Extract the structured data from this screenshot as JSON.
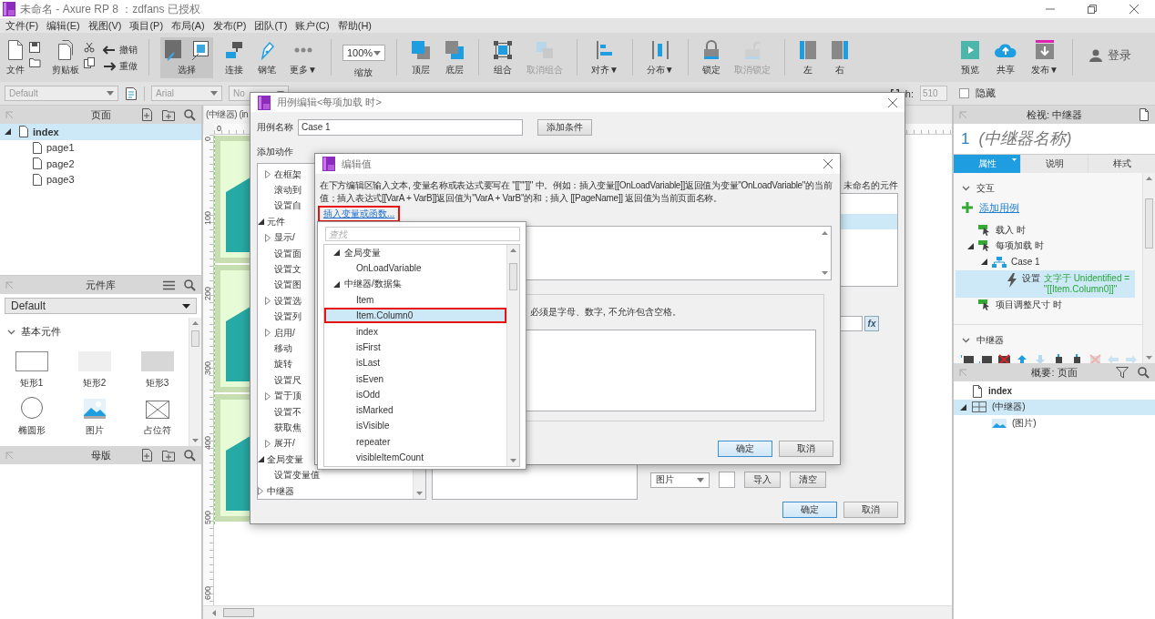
{
  "window": {
    "title": "未命名 - Axure RP 8 ：zdfans 已授权"
  },
  "menu": [
    "文件(F)",
    "编辑(E)",
    "视图(V)",
    "项目(P)",
    "布局(A)",
    "发布(P)",
    "团队(T)",
    "账户(C)",
    "帮助(H)"
  ],
  "toolbar": {
    "left": [
      {
        "kind": "file",
        "label": "文件",
        "disabled": false,
        "selected": false
      },
      {
        "kind": "clipboard",
        "label": "剪贴板",
        "disabled": false,
        "selected": false
      },
      {
        "kind": "history",
        "items": [
          {
            "kind": "undo",
            "label": "撤销"
          },
          {
            "kind": "redo",
            "label": "重做"
          }
        ]
      },
      {
        "kind": "separator"
      },
      {
        "kind": "select",
        "label": "选择",
        "disabled": false,
        "selected": true
      },
      {
        "kind": "connect",
        "label": "连接",
        "disabled": false,
        "selected": false
      },
      {
        "kind": "pen",
        "label": "钢笔",
        "disabled": false,
        "selected": false
      },
      {
        "kind": "more",
        "label": "更多▼",
        "disabled": false,
        "selected": false
      },
      {
        "kind": "separator"
      },
      {
        "kind": "zoom",
        "value": "100%",
        "label": "缩放"
      },
      {
        "kind": "separator"
      },
      {
        "kind": "front",
        "label": "顶层",
        "disabled": false,
        "selected": false
      },
      {
        "kind": "back",
        "label": "底层",
        "disabled": false,
        "selected": false
      },
      {
        "kind": "separator"
      },
      {
        "kind": "group",
        "label": "组合",
        "disabled": false,
        "selected": false
      },
      {
        "kind": "ungroup",
        "label": "取消组合",
        "disabled": true,
        "selected": false
      },
      {
        "kind": "separator"
      },
      {
        "kind": "align",
        "label": "对齐▼",
        "disabled": false,
        "selected": false
      },
      {
        "kind": "separator"
      },
      {
        "kind": "distribute",
        "label": "分布▼",
        "disabled": false,
        "selected": false
      },
      {
        "kind": "separator"
      },
      {
        "kind": "lock",
        "label": "锁定",
        "disabled": false,
        "selected": false
      },
      {
        "kind": "unlock",
        "label": "取消锁定",
        "disabled": true,
        "selected": false
      },
      {
        "kind": "separator"
      },
      {
        "kind": "left",
        "label": "左",
        "disabled": false,
        "selected": false
      },
      {
        "kind": "right",
        "label": "右",
        "disabled": false,
        "selected": false
      }
    ],
    "right": [
      {
        "kind": "preview",
        "label": "预览",
        "disabled": false,
        "selected": false
      },
      {
        "kind": "share",
        "label": "共享",
        "disabled": false,
        "selected": false
      },
      {
        "kind": "publish",
        "label": "发布▼",
        "disabled": false,
        "selected": false
      },
      {
        "kind": "separator"
      },
      {
        "kind": "login",
        "label": "登录"
      }
    ]
  },
  "stylebar": {
    "style": "Default",
    "font": "Arial",
    "weight": "No",
    "h_label": "h:",
    "h_value": "510",
    "hidden": {
      "label": "隐藏",
      "checked": false
    }
  },
  "pages_panel": {
    "title": "页面",
    "tree": [
      {
        "label": "index",
        "selected": true,
        "expanded": true,
        "children": [
          {
            "label": "page1",
            "selected": false
          },
          {
            "label": "page2",
            "selected": false
          },
          {
            "label": "page3",
            "selected": false
          }
        ]
      }
    ]
  },
  "library_panel": {
    "title": "元件库",
    "library": "Default",
    "section": "基本元件",
    "widgets": [
      {
        "kind": "rect",
        "label": "矩形1"
      },
      {
        "kind": "rect2",
        "label": "矩形2"
      },
      {
        "kind": "rect3",
        "label": "矩形3"
      },
      {
        "kind": "ellipse",
        "label": "椭圆形"
      },
      {
        "kind": "image",
        "label": "图片"
      },
      {
        "kind": "placeholder",
        "label": "占位符"
      }
    ]
  },
  "masters_panel": {
    "title": "母版"
  },
  "canvas": {
    "tab": "(中继器) (in",
    "horizontal_ruler": [
      "0"
    ],
    "vertical_ruler": [
      "0",
      "100",
      "200",
      "300",
      "400",
      "500",
      "600"
    ]
  },
  "inspector": {
    "title": "检视: 中继器",
    "number": "1",
    "name_placeholder": "(中继器名称)",
    "tabs": [
      {
        "label": "属性",
        "selected": true
      },
      {
        "label": "说明",
        "selected": false
      },
      {
        "label": "样式",
        "selected": false
      }
    ],
    "interaction_title": "交互",
    "add_case": "添加用例",
    "events": [
      {
        "kind": "event",
        "label": "载入 时",
        "selected": false
      },
      {
        "kind": "event",
        "label": "每项加载 时",
        "selected": false,
        "expanded": true,
        "children": [
          {
            "kind": "case",
            "label": "Case 1",
            "selected": false,
            "expanded": true,
            "children": [
              {
                "kind": "action",
                "verb": "设置",
                "detail": "文字于 Unidentified = \"[[Item.Column0]]\"",
                "selected": true
              }
            ]
          }
        ]
      },
      {
        "kind": "event",
        "label": "项目调整尺寸 时",
        "selected": false
      }
    ],
    "repeater_title": "中继器"
  },
  "outline": {
    "title": "概要: 页面",
    "tree": [
      {
        "kind": "page",
        "label": "index",
        "selected": false
      },
      {
        "kind": "repeater",
        "label": "(中继器)",
        "selected": true,
        "expanded": true,
        "children": [
          {
            "kind": "image",
            "label": "(图片)",
            "selected": false
          }
        ]
      }
    ]
  },
  "case_dialog": {
    "title": "用例编辑<每项加载 时>",
    "name_label": "用例名称",
    "name_value": "Case 1",
    "add_condition": "添加条件",
    "actions_title": "添加动作",
    "actions": [
      {
        "kind": "partial",
        "children": [
          {
            "kind": "group",
            "label": "在框架",
            "expanded": false
          },
          {
            "kind": "action",
            "label": "滚动到"
          },
          {
            "kind": "action",
            "label": "设置自"
          }
        ]
      },
      {
        "kind": "group",
        "label": "元件",
        "expanded": true,
        "children": [
          {
            "kind": "group",
            "label": "显示/",
            "expanded": false
          },
          {
            "kind": "action",
            "label": "设置面"
          },
          {
            "kind": "action",
            "label": "设置文"
          },
          {
            "kind": "action",
            "label": "设置图"
          },
          {
            "kind": "group",
            "label": "设置选",
            "expanded": false
          },
          {
            "kind": "action",
            "label": "设置列"
          },
          {
            "kind": "group",
            "label": "启用/",
            "expanded": false
          },
          {
            "kind": "action",
            "label": "移动"
          },
          {
            "kind": "action",
            "label": "旋转"
          },
          {
            "kind": "action",
            "label": "设置尺"
          },
          {
            "kind": "group",
            "label": "置于顶",
            "expanded": false
          },
          {
            "kind": "action",
            "label": "设置不"
          },
          {
            "kind": "action",
            "label": "获取焦"
          },
          {
            "kind": "group",
            "label": "展开/",
            "expanded": false
          }
        ]
      },
      {
        "kind": "group",
        "label": "全局变量",
        "expanded": true,
        "children": [
          {
            "kind": "action",
            "label": "设置变量值"
          }
        ]
      },
      {
        "kind": "group",
        "label": "中继器",
        "expanded": false
      }
    ],
    "config_note": "未命名的元件",
    "expression_button": "fx",
    "image_select": "图片",
    "import": "导入",
    "clear": "清空",
    "ok": "确定",
    "cancel": "取消"
  },
  "value_dialog": {
    "title": "编辑值",
    "description": "在下方编辑区输入文本, 变量名称或表达式要写在 \"[[\"\"]]\" 中。例如：插入变量[[OnLoadVariable]]返回值为变量\"OnLoadVariable\"的当前值；插入表达式[[VarA + VarB]]返回值为\"VarA + VarB\"的和；插入 [[PageName]] 返回值为当前页面名称。",
    "insert_link": {
      "label": "插入变量或函数...",
      "annotated": true
    },
    "local_hint": "必须是字母、数字, 不允许包含空格。",
    "ok": "确定",
    "cancel": "取消"
  },
  "variable_popup": {
    "search_placeholder": "查找",
    "tree": [
      {
        "label": "全局变量",
        "expanded": true,
        "selected": false,
        "annotated": false,
        "children": [
          {
            "label": "OnLoadVariable",
            "selected": false,
            "annotated": false
          }
        ]
      },
      {
        "label": "中继器/数据集",
        "expanded": true,
        "selected": false,
        "annotated": false,
        "children": [
          {
            "label": "Item",
            "selected": false,
            "annotated": false
          },
          {
            "label": "Item.Column0",
            "selected": true,
            "annotated": true
          },
          {
            "label": "index",
            "selected": false,
            "annotated": false
          },
          {
            "label": "isFirst",
            "selected": false,
            "annotated": false
          },
          {
            "label": "isLast",
            "selected": false,
            "annotated": false
          },
          {
            "label": "isEven",
            "selected": false,
            "annotated": false
          },
          {
            "label": "isOdd",
            "selected": false,
            "annotated": false
          },
          {
            "label": "isMarked",
            "selected": false,
            "annotated": false
          },
          {
            "label": "isVisible",
            "selected": false,
            "annotated": false
          },
          {
            "label": "repeater",
            "selected": false,
            "annotated": false
          },
          {
            "label": "visibleItemCount",
            "selected": false,
            "annotated": false
          }
        ]
      }
    ]
  }
}
